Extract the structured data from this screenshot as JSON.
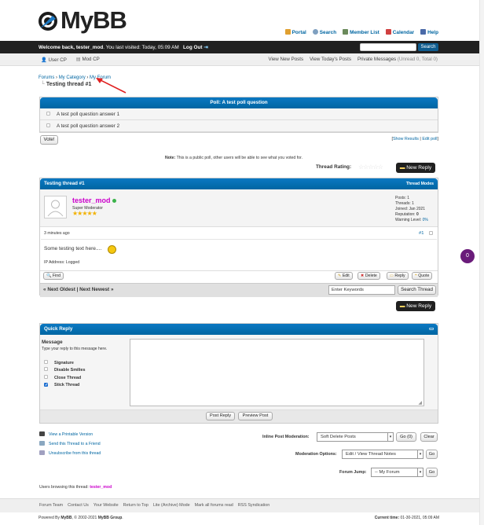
{
  "logo": {
    "text": "MyBB"
  },
  "toplinks": [
    {
      "label": "Portal",
      "icon": "portal-icon",
      "color": "#e0a030"
    },
    {
      "label": "Search",
      "icon": "search-icon",
      "color": "#7fa0c0"
    },
    {
      "label": "Member List",
      "icon": "members-icon",
      "color": "#6b8a5b"
    },
    {
      "label": "Calendar",
      "icon": "calendar-icon",
      "color": "#d04040"
    },
    {
      "label": "Help",
      "icon": "help-icon",
      "color": "#4a6aa8"
    }
  ],
  "welcome": {
    "prefix": "Welcome back, ",
    "user": "tester_mod",
    "visited": ". You last visited: Today, 05:09 AM",
    "logout": "Log Out",
    "search_button": "Search"
  },
  "subbar": {
    "user_cp": "User CP",
    "mod_cp": "Mod CP",
    "view_new": "View New Posts",
    "view_today": "View Today's Posts",
    "pm": "Private Messages",
    "pm_counts": "(Unread 0, Total 0)"
  },
  "breadcrumb": {
    "forums": "Forums",
    "category": "My Category",
    "forum": "My Forum",
    "sep": "›",
    "current": "Testing thread #1"
  },
  "poll": {
    "title": "Poll: A test poll question",
    "options": [
      "A test poll question answer 1",
      "A test poll question answer 2"
    ],
    "vote": "Vote!",
    "show_results": "Show Results",
    "edit_poll": "Edit poll",
    "note_label": "Note:",
    "note": "This is a public poll, other users will be able to see what you voted for."
  },
  "rating": {
    "label": "Thread Rating:",
    "stars": "☆☆☆☆☆"
  },
  "new_reply": "New Reply",
  "thread": {
    "title": "Testing thread #1",
    "modes": "Thread Modes",
    "author": {
      "name": "tester_mod",
      "title": "Super Moderator",
      "stars": "★★★★★",
      "posts": "Posts: 1",
      "threads": "Threads: 1",
      "joined": "Joined: Jan 2021",
      "reputation_label": "Reputation: ",
      "reputation": "0",
      "warning_label": "Warning Level: ",
      "warning": "0%"
    },
    "post_date": "3 minutes ago",
    "post_num": "#1",
    "text": "Some testing text here....",
    "ip": "IP Address: Logged",
    "buttons": {
      "find": "Find",
      "edit": "Edit",
      "delete": "Delete",
      "reply": "Reply",
      "quote": "Quote"
    },
    "nav": "« Next Oldest | Next Newest »",
    "keywords_placeholder": "Enter Keywords",
    "search_thread": "Search Thread"
  },
  "quick_reply": {
    "title": "Quick Reply",
    "message": "Message",
    "hint": "Type your reply to this message here.",
    "options": [
      {
        "label": "Signature",
        "checked": false
      },
      {
        "label": "Disable Smilies",
        "checked": false
      },
      {
        "label": "Close Thread",
        "checked": false
      },
      {
        "label": "Stick Thread",
        "checked": true
      }
    ],
    "post_reply": "Post Reply",
    "preview": "Preview Post"
  },
  "footer_links": [
    "View a Printable Version",
    "Send this Thread to a Friend",
    "Unsubscribe from this thread"
  ],
  "moderation": {
    "inline_label": "Inline Post Moderation:",
    "inline_value": "Soft Delete Posts",
    "inline_go": "Go (0)",
    "clear": "Clear",
    "options_label": "Moderation Options:",
    "options_value": "Edit / View Thread Notes",
    "jump_label": "Forum Jump:",
    "jump_value": "-- My Forum",
    "go": "Go"
  },
  "browsing": {
    "label": "Users browsing this thread: ",
    "user": "tester_mod"
  },
  "bottom_links": [
    "Forum Team",
    "Contact Us",
    "Your Website",
    "Return to Top",
    "Lite (Archive) Mode",
    "Mark all forums read",
    "RSS Syndication"
  ],
  "powered": {
    "prefix": "Powered By ",
    "mybb": "MyBB",
    "copy": ", © 2002-2021 ",
    "group": "MyBB Group",
    "end": "."
  },
  "current_time": {
    "label": "Current time:",
    "value": "01-30-2021, 05:09 AM"
  },
  "badge": "0"
}
